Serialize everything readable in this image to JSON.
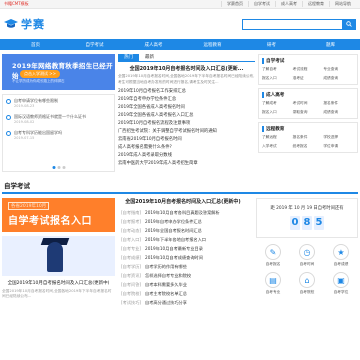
{
  "topbar": {
    "notice": "书籍CMT模板",
    "links": [
      "学赛首页",
      "自学考试",
      "成人高考",
      "远程教育",
      "网站导航"
    ]
  },
  "header": {
    "logo_text": "学赛",
    "search_placeholder": ""
  },
  "nav": [
    "首页",
    "自学考试",
    "成人高考",
    "远程教育",
    "研考",
    "题库"
  ],
  "banner": {
    "title": "2019年网络教育秋季招生已经开始",
    "button": "点击入学测试 >>",
    "sub": "不让学历成为你成长路上的绊脚石"
  },
  "notes": [
    {
      "text": "自考申请学位有哪些限制",
      "date": "2019-08-23"
    },
    {
      "text": "国际汉语教师资格证书就是一个什么证书",
      "date": "2019-08-02"
    },
    {
      "text": "自考专科学历能出国留学吗",
      "date": "2019-07-15"
    }
  ],
  "tabs": [
    "热门",
    "最新"
  ],
  "headline": "全国2019年10月自考报名时间及入口汇总(更新...",
  "desc": "全国2019年10月自考报名时间,全国各地2019年下半年自考报名时间已经陆续公布,考生可根据当地自考办发布的时间进行报名,请考生及时关注...",
  "news": [
    "2019年10月自考报名工作安排汇总",
    "2019年自考申办学位条件汇总",
    "2019年全国各省成人高考报名时间",
    "2019年全国各省成人高考报名入口汇总",
    "2019年10月自考报名流程及注意事项",
    "广西招生考试院：关于调整自学考试报名时间的通知",
    "云南省2019年10月自考报名时间",
    "成人高考报名需要什么条件?",
    "2019年成人高考录取分数线",
    "云南中医药大学2019年成人高考招生简章"
  ],
  "right_boxes": [
    {
      "title": "自学考试",
      "items": [
        "了解自考",
        "考试流程",
        "专业查询",
        "报名入口",
        "准考证",
        "成绩查询"
      ]
    },
    {
      "title": "成人高考",
      "items": [
        "了解成考",
        "考试时间",
        "报名条件",
        "报名入口",
        "录取查询",
        "成绩查询"
      ]
    },
    {
      "title": "远程教育",
      "items": [
        "了解远程",
        "报名条件",
        "学校选择",
        "入学考试",
        "统考报名",
        "学位申请"
      ]
    }
  ],
  "section_title": "自学考试",
  "exam_banner": {
    "tag": "各省2019年10月",
    "big": "自学考试报名入口"
  },
  "bottom_news": {
    "title": "全国2019年10月自考报名时间及入口汇总(更新中)",
    "desc": "全国2019年10月自考报名时间,全国各地2019年下半年自考报名时间已经陆续公布..."
  },
  "mid_headline": "全国2019年10月自考报名时间及入口汇总(更新中)",
  "list2": [
    {
      "tag": "[自考指南]",
      "title": "2019年10月自考各科目真题及答案解析"
    },
    {
      "tag": "[自考报考]",
      "title": "2019年自考申办学位条件汇总"
    },
    {
      "tag": "[自考动态]",
      "title": "2019年全国自考报名时间汇总"
    },
    {
      "tag": "[自考入口]",
      "title": "2019年下半年各地自考报名入口"
    },
    {
      "tag": "[自考专业]",
      "title": "2019年10月自考最新专业目录"
    },
    {
      "tag": "[自考成绩]",
      "title": "2019年10月自考成绩查询时间"
    },
    {
      "tag": "[自考学历]",
      "title": "自考学历的作用有哪些"
    },
    {
      "tag": "[自考资讯]",
      "title": "怎样选择自考专业和院校"
    },
    {
      "tag": "[自考问答]",
      "title": "自考本科需要多久毕业"
    },
    {
      "tag": "[自考院校]",
      "title": "自考主考院校名单汇总"
    },
    {
      "tag": "[考试技巧]",
      "title": "自考高分通过技巧分享"
    }
  ],
  "countdown": {
    "title": "距 2019 年 10 月 19 日自考时间还有",
    "digits": [
      "0",
      "8",
      "5"
    ]
  },
  "icons": [
    {
      "icon": "报名-icon",
      "label": "自考报名"
    },
    {
      "icon": "时间-icon",
      "label": "自考时间"
    },
    {
      "icon": "成绩-icon",
      "label": "自考成绩"
    },
    {
      "icon": "专业-icon",
      "label": "自考专业"
    },
    {
      "icon": "院校-icon",
      "label": "自考院校"
    },
    {
      "icon": "学位-icon",
      "label": "自考学位"
    }
  ],
  "colors": {
    "accent": "#1e88e5",
    "orange": "#ff7f2a",
    "notice": "#e0322b"
  }
}
